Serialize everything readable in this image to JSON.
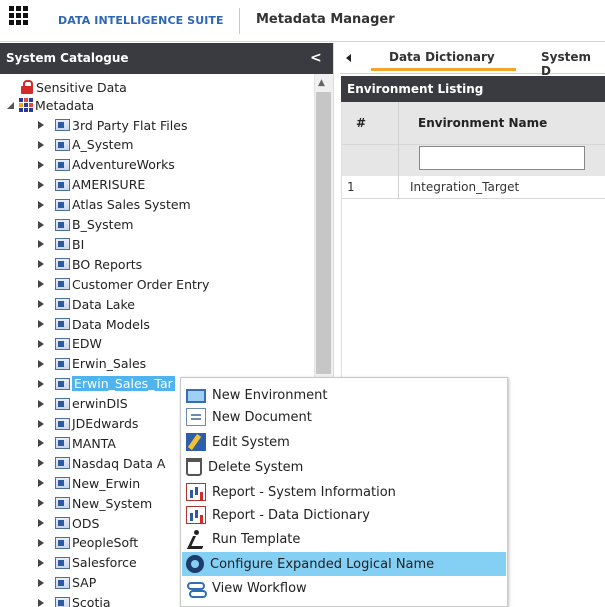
{
  "topbar": {
    "suite": "DATA INTELLIGENCE SUITE",
    "app": "Metadata Manager"
  },
  "sidebar": {
    "title": "System Catalogue",
    "collapse_glyph": "<",
    "sensitive": "Sensitive Data",
    "metadata": "Metadata",
    "systems": [
      "3rd Party Flat Files",
      "A_System",
      "AdventureWorks",
      "AMERISURE",
      "Atlas Sales System",
      "B_System",
      "BI",
      "BO Reports",
      "Customer Order Entry",
      "Data Lake",
      "Data Models",
      "EDW",
      "Erwin_Sales",
      "Erwin_Sales_Tar",
      "erwinDIS",
      "JDEdwards",
      "MANTA",
      "Nasdaq Data A",
      "New_Erwin",
      "New_System",
      "ODS",
      "PeopleSoft",
      "Salesforce",
      "SAP",
      "Scotia"
    ],
    "selected_index": 13
  },
  "tabs": {
    "data_dictionary": "Data Dictionary",
    "system": "System D"
  },
  "env": {
    "title": "Environment Listing",
    "col_num": "#",
    "col_name": "Environment Name",
    "rows": [
      {
        "num": "1",
        "name": "Integration_Target"
      }
    ]
  },
  "context_menu": {
    "items": [
      {
        "label": "New Environment",
        "icon": "monitor-icon"
      },
      {
        "label": "New Document",
        "icon": "document-icon"
      },
      {
        "label": "Edit System",
        "icon": "edit-icon"
      },
      {
        "label": "Delete System",
        "icon": "trash-icon"
      },
      {
        "label": "Report - System Information",
        "icon": "report-icon"
      },
      {
        "label": "Report - Data Dictionary",
        "icon": "report-icon"
      },
      {
        "label": "Run Template",
        "icon": "run-icon"
      },
      {
        "label": "Configure Expanded Logical Name",
        "icon": "gear-icon"
      },
      {
        "label": "View Workflow",
        "icon": "workflow-icon"
      }
    ],
    "active_index": 7
  },
  "colors": {
    "accent": "#f3a52b",
    "header": "#393b40",
    "selected": "#4fb3ef",
    "menu_hover": "#84d0f5",
    "brand": "#2e66b6"
  }
}
